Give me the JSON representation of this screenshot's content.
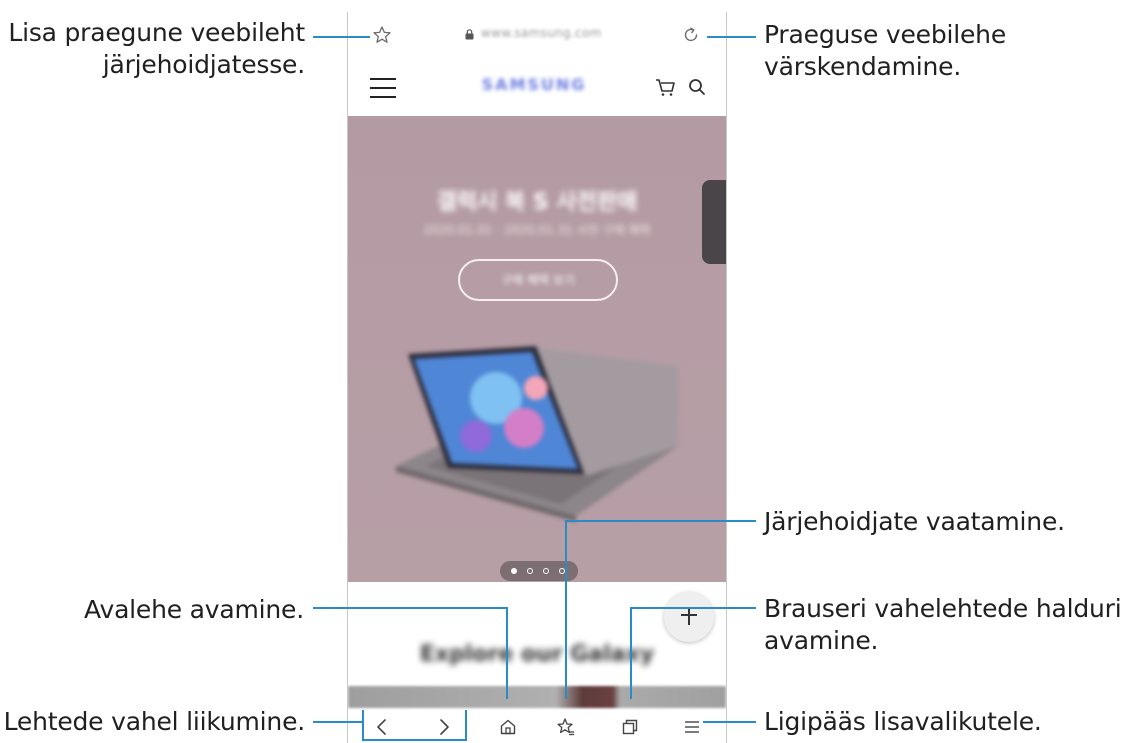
{
  "callouts": {
    "bookmark_add": [
      "Lisa praegune veebileht",
      "järjehoidjatesse."
    ],
    "refresh": [
      "Praeguse veebilehe",
      "värskendamine."
    ],
    "bookmarks_view": "Järjehoidjate vaatamine.",
    "home_open": "Avalehe avamine.",
    "tabs_manager": [
      "Brauseri vahelehtede halduri",
      "avamine."
    ],
    "navigate_pages": "Lehtede vahel liikumine.",
    "more_options": "Ligipääs lisavalikutele."
  },
  "browser": {
    "url": "www.samsung.com",
    "site_logo": "SAMSUNG",
    "hero_title": "갤럭시 북 S 사전판매",
    "hero_subtitle": "2020.01.01 - 2020.01.31 사전 구매 혜택",
    "hero_cta": "구매 혜택 보기",
    "section_title": "Explore our Galaxy",
    "carousel_active_index": 0,
    "carousel_count": 4
  },
  "icons": {
    "bookmark_add": "star-outline-icon",
    "lock": "lock-icon",
    "reload": "reload-icon",
    "menu": "hamburger-icon",
    "cart": "cart-icon",
    "search": "search-icon",
    "fab": "plus-icon",
    "back": "chevron-left-icon",
    "forward": "chevron-right-icon",
    "home": "home-icon",
    "bookmarks": "star-list-icon",
    "tabs": "tabs-icon",
    "more": "menu-lines-icon"
  },
  "colors": {
    "leader_line": "#2a8bc9",
    "hero_background": "#b59ca4",
    "logo": "#6e7fe0"
  }
}
